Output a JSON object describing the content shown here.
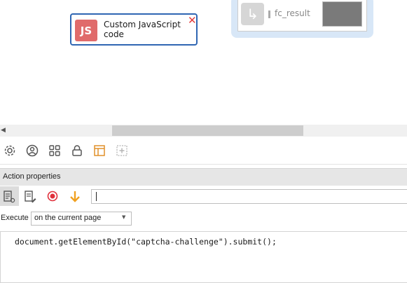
{
  "canvas": {
    "js_block": {
      "icon_text": "JS",
      "title": "Custom JavaScript code",
      "close_glyph": "✕"
    },
    "result_block": {
      "arrow_glyph": "↳",
      "label": "fc_result"
    }
  },
  "scroll": {
    "left_glyph": "◀"
  },
  "toolbar": {
    "icons": [
      "gear-icon",
      "user-circle-icon",
      "grid-icon",
      "lock-icon",
      "table-icon",
      "add-box-icon"
    ]
  },
  "properties": {
    "title": "Action properties",
    "code_input_value": "",
    "execute_label": "Execute",
    "execute_value": "on the current page",
    "code": "document.getElementById(\"captcha-challenge\").submit();"
  },
  "colors": {
    "js_icon": "#e06b6b",
    "block_border": "#2f66b3",
    "close": "#e23b3b",
    "record": "#e0303b",
    "down_arrow": "#f0a020",
    "table_icon": "#e0902a"
  }
}
